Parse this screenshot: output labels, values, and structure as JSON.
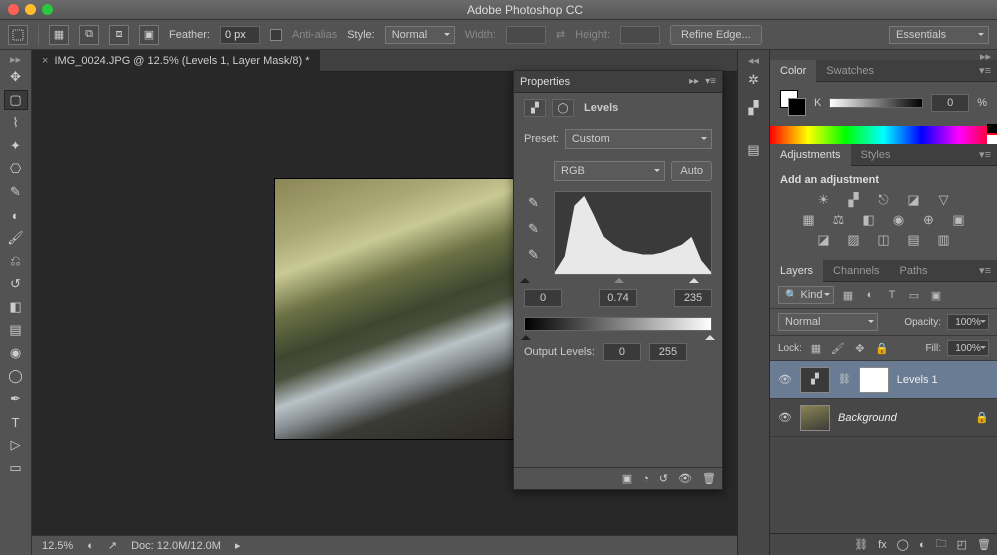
{
  "app": {
    "title": "Adobe Photoshop CC"
  },
  "options": {
    "feather_label": "Feather:",
    "feather_value": "0 px",
    "antialias_label": "Anti-alias",
    "style_label": "Style:",
    "style_value": "Normal",
    "width_label": "Width:",
    "height_label": "Height:",
    "refine_label": "Refine Edge...",
    "workspace": "Essentials"
  },
  "document": {
    "tab_title": "IMG_0024.JPG @ 12.5% (Levels 1, Layer Mask/8) *",
    "zoom": "12.5%",
    "docsize": "Doc: 12.0M/12.0M"
  },
  "properties": {
    "title": "Properties",
    "type_label": "Levels",
    "preset_label": "Preset:",
    "preset_value": "Custom",
    "channel": "RGB",
    "auto_label": "Auto",
    "in_black": "0",
    "in_mid": "0.74",
    "in_white": "235",
    "output_label": "Output Levels:",
    "out_black": "0",
    "out_white": "255"
  },
  "panels": {
    "color_tab": "Color",
    "swatches_tab": "Swatches",
    "k_label": "K",
    "k_value": "0",
    "k_pct": "%",
    "adjustments_tab": "Adjustments",
    "styles_tab": "Styles",
    "add_adjustment": "Add an adjustment",
    "layers_tab": "Layers",
    "channels_tab": "Channels",
    "paths_tab": "Paths",
    "kind_label": "Kind",
    "blend_mode": "Normal",
    "opacity_label": "Opacity:",
    "opacity_value": "100%",
    "lock_label": "Lock:",
    "fill_label": "Fill:",
    "fill_value": "100%",
    "layer1_name": "Levels 1",
    "layer2_name": "Background"
  },
  "chart_data": {
    "type": "area",
    "title": "Levels histogram",
    "xlabel": "",
    "ylabel": "",
    "x": [
      0,
      16,
      32,
      48,
      64,
      80,
      96,
      112,
      128,
      144,
      160,
      176,
      192,
      208,
      224,
      240,
      255
    ],
    "values": [
      2,
      18,
      70,
      95,
      60,
      38,
      30,
      24,
      22,
      20,
      20,
      22,
      26,
      30,
      38,
      14,
      2
    ],
    "ylim": [
      0,
      100
    ],
    "input_sliders": {
      "black": 0,
      "mid": 0.74,
      "white": 235
    },
    "output_sliders": {
      "black": 0,
      "white": 255
    }
  }
}
